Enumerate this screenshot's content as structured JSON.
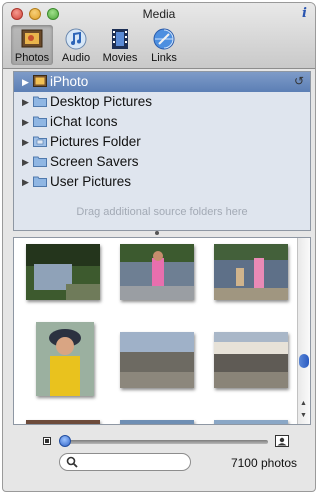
{
  "window": {
    "title": "Media"
  },
  "tabs": [
    {
      "label": "Photos",
      "icon": "photos-icon",
      "active": true
    },
    {
      "label": "Audio",
      "icon": "audio-icon",
      "active": false
    },
    {
      "label": "Movies",
      "icon": "movies-icon",
      "active": false
    },
    {
      "label": "Links",
      "icon": "links-icon",
      "active": false
    }
  ],
  "sources": {
    "items": [
      {
        "label": "iPhoto",
        "icon": "iphoto-icon",
        "selected": true
      },
      {
        "label": "Desktop Pictures",
        "icon": "folder-icon",
        "selected": false
      },
      {
        "label": "iChat Icons",
        "icon": "folder-icon",
        "selected": false
      },
      {
        "label": "Pictures Folder",
        "icon": "pictures-folder-icon",
        "selected": false
      },
      {
        "label": "Screen Savers",
        "icon": "folder-icon",
        "selected": false
      },
      {
        "label": "User Pictures",
        "icon": "folder-icon",
        "selected": false
      }
    ],
    "hint": "Drag additional source folders here"
  },
  "status": {
    "photo_count": "7100 photos"
  },
  "search": {
    "placeholder": ""
  },
  "colors": {
    "selection": "#6383b8",
    "accent": "#2f63c7"
  }
}
